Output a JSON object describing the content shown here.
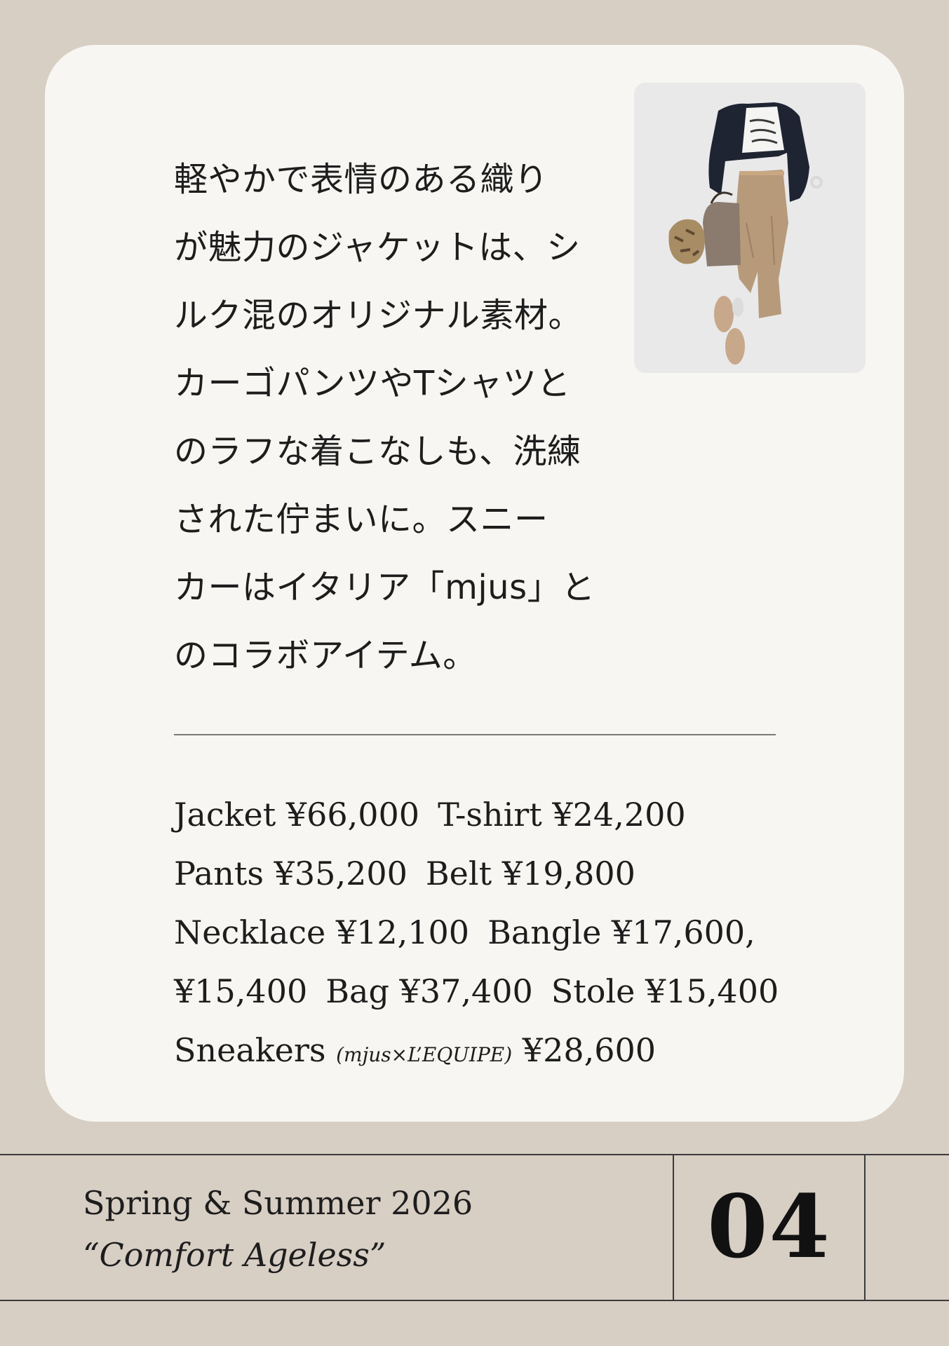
{
  "card": {
    "body_lines": [
      "軽やかで表情のある織り",
      "が魅力のジャケットは、シ",
      "ルク混のオリジナル素材。",
      "カーゴパンツやTシャツと",
      "のラフな着こなしも、洗練",
      "された佇まいに。スニー",
      "カーはイタリア「mjus」と",
      "のコラボアイテム。"
    ],
    "credits": {
      "row1": {
        "item1": "Jacket ¥66,000",
        "item2": "T-shirt ¥24,200"
      },
      "row2": {
        "item1": "Pants ¥35,200",
        "item2": "Belt ¥19,800"
      },
      "row3": {
        "item1": "Necklace ¥12,100",
        "item2": "Bangle ¥17,600,"
      },
      "row4": {
        "item1": "¥15,400",
        "item2": "Bag ¥37,400",
        "item3": "Stole ¥15,400"
      },
      "row5": {
        "item": "Sneakers",
        "brand": "(mjus×L’EQUIPE)",
        "price": "¥28,600"
      }
    }
  },
  "footer": {
    "season": "Spring & Summer 2026",
    "theme": "“Comfort Ageless”",
    "page_number": "04"
  },
  "colors": {
    "background": "#d7cec4",
    "card": "#f7f6f2",
    "text": "#1d1d1d"
  }
}
